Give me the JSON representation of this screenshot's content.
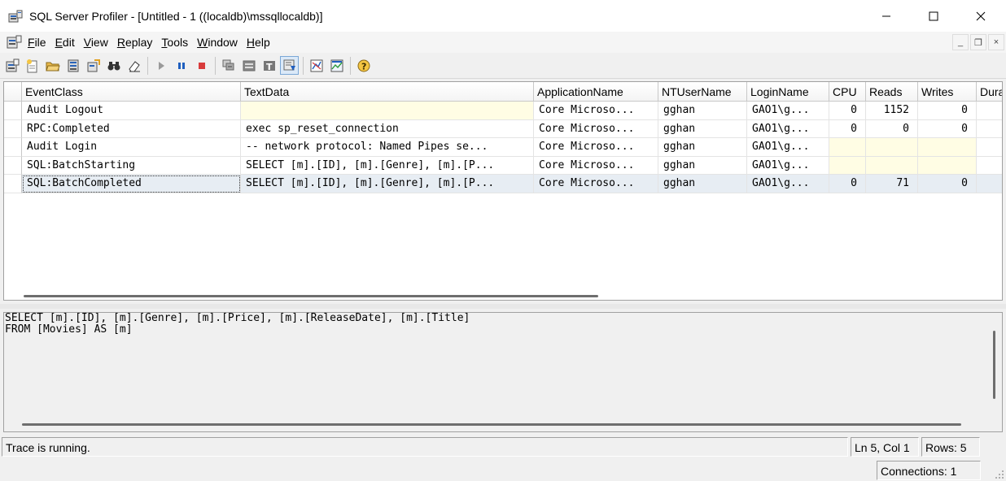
{
  "window": {
    "title": "SQL Server Profiler - [Untitled - 1 ((localdb)\\mssqllocaldb)]",
    "minimize_glyph": "—",
    "maximize_glyph": "☐",
    "close_glyph": "✕"
  },
  "menu": {
    "items": [
      {
        "label": "File",
        "accel": "F"
      },
      {
        "label": "Edit",
        "accel": "E"
      },
      {
        "label": "View",
        "accel": "V"
      },
      {
        "label": "Replay",
        "accel": "R"
      },
      {
        "label": "Tools",
        "accel": "T"
      },
      {
        "label": "Window",
        "accel": "W"
      },
      {
        "label": "Help",
        "accel": "H"
      }
    ],
    "mdi": {
      "minimize": "_",
      "restore": "❐",
      "close": "×"
    }
  },
  "toolbar": {
    "icons": [
      "new-trace-icon",
      "new-template-icon",
      "open-icon",
      "save-icon",
      "properties-icon",
      "find-icon",
      "clear-icon",
      "run-icon",
      "pause-icon",
      "stop-icon",
      "scroll-icon",
      "columns-icon",
      "text-icon",
      "autoscroll-icon",
      "performance-icon",
      "chart-icon",
      "help-icon"
    ]
  },
  "grid": {
    "columns": [
      "EventClass",
      "TextData",
      "ApplicationName",
      "NTUserName",
      "LoginName",
      "CPU",
      "Reads",
      "Writes",
      "Dura"
    ],
    "rows": [
      {
        "EventClass": "Audit Logout",
        "TextData": "",
        "ApplicationName": "Core Microso...",
        "NTUserName": "gghan",
        "LoginName": "GAO1\\g...",
        "CPU": "0",
        "Reads": "1152",
        "Writes": "0",
        "Dura": ""
      },
      {
        "EventClass": "RPC:Completed",
        "TextData": "exec sp_reset_connection",
        "ApplicationName": "Core Microso...",
        "NTUserName": "gghan",
        "LoginName": "GAO1\\g...",
        "CPU": "0",
        "Reads": "0",
        "Writes": "0",
        "Dura": ""
      },
      {
        "EventClass": "Audit Login",
        "TextData": "-- network protocol: Named Pipes  se...",
        "ApplicationName": "Core Microso...",
        "NTUserName": "gghan",
        "LoginName": "GAO1\\g...",
        "CPU": "",
        "Reads": "",
        "Writes": "",
        "Dura": ""
      },
      {
        "EventClass": "SQL:BatchStarting",
        "TextData": "SELECT [m].[ID], [m].[Genre], [m].[P...",
        "ApplicationName": "Core Microso...",
        "NTUserName": "gghan",
        "LoginName": "GAO1\\g...",
        "CPU": "",
        "Reads": "",
        "Writes": "",
        "Dura": ""
      },
      {
        "EventClass": "SQL:BatchCompleted",
        "TextData": "SELECT [m].[ID], [m].[Genre], [m].[P...",
        "ApplicationName": "Core Microso...",
        "NTUserName": "gghan",
        "LoginName": "GAO1\\g...",
        "CPU": "0",
        "Reads": "71",
        "Writes": "0",
        "Dura": ""
      }
    ],
    "selected_row": 4
  },
  "detail": {
    "text": "SELECT [m].[ID], [m].[Genre], [m].[Price], [m].[ReleaseDate], [m].[Title]\nFROM [Movies] AS [m]"
  },
  "status": {
    "message": "Trace is running.",
    "position": "Ln 5, Col 1",
    "rows": "Rows: 5",
    "connections": "Connections: 1"
  }
}
